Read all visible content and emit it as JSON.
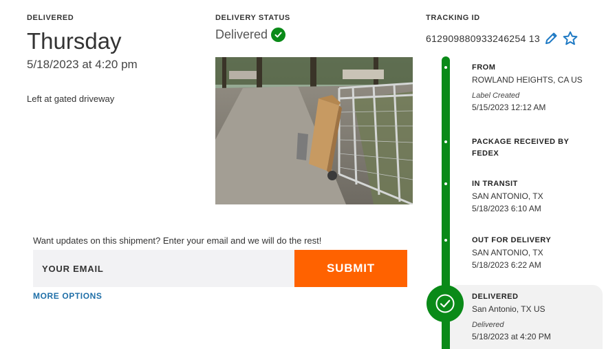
{
  "delivered": {
    "heading": "DELIVERED",
    "day": "Thursday",
    "datetime": "5/18/2023 at 4:20 pm",
    "note": "Left at gated driveway"
  },
  "delivery_status": {
    "heading": "DELIVERY STATUS",
    "status": "Delivered"
  },
  "tracking": {
    "heading": "TRACKING ID",
    "id": "612909880933246254 13"
  },
  "timeline": [
    {
      "title": "FROM",
      "lines": [
        "ROWLAND HEIGHTS, CA US"
      ],
      "sub": "Label Created",
      "date": "5/15/2023 12:12 AM"
    },
    {
      "title_1": "PACKAGE RECEIVED BY",
      "title_2": "FEDEX"
    },
    {
      "title": "IN TRANSIT",
      "lines": [
        "SAN ANTONIO, TX"
      ],
      "date": "5/18/2023 6:10 AM"
    },
    {
      "title": "OUT FOR DELIVERY",
      "lines": [
        "SAN ANTONIO, TX"
      ],
      "date": "5/18/2023 6:22 AM"
    },
    {
      "title": "DELIVERED",
      "lines": [
        "San Antonio, TX US"
      ],
      "sub": "Delivered",
      "date": "5/18/2023 at 4:20 PM"
    }
  ],
  "email_form": {
    "prompt": "Want updates on this shipment? Enter your email and we will do the rest!",
    "placeholder": "YOUR EMAIL",
    "submit_label": "SUBMIT",
    "more_options": "MORE OPTIONS"
  },
  "colors": {
    "accent_green": "#0a8a18",
    "submit_orange": "#ff6200",
    "link_blue": "#1f6fa8",
    "icon_blue": "#1f7ac4"
  },
  "icons": {
    "status": "check-circle-icon",
    "edit": "pencil-icon",
    "favorite": "star-outline-icon",
    "final_step": "check-circle-icon"
  }
}
